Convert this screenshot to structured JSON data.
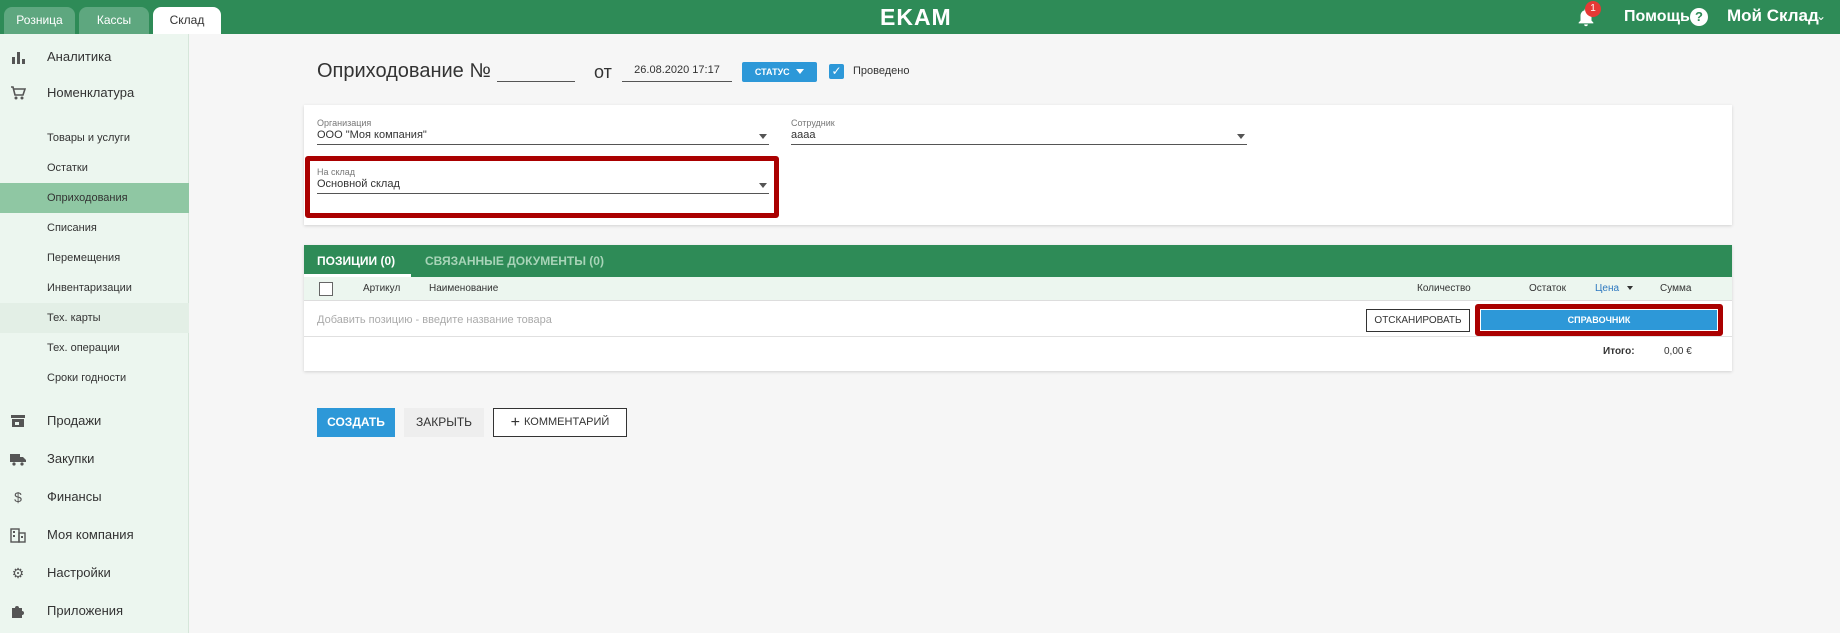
{
  "topbar": {
    "tabs": [
      {
        "label": "Розница"
      },
      {
        "label": "Кассы"
      },
      {
        "label": "Склад"
      }
    ],
    "logo": "EKAM",
    "notifications_count": "1",
    "help_label": "Помощь",
    "help_icon": "?",
    "account_label": "Мой Склад",
    "account_chevron": "⌄"
  },
  "sidebar": {
    "items": [
      {
        "label": "Аналитика",
        "icon": "bar-chart-icon",
        "glyph": "▮"
      },
      {
        "label": "Номенклатура",
        "icon": "cart-icon",
        "glyph": "🛒"
      },
      {
        "label": "Продажи",
        "icon": "store-icon",
        "glyph": "▬"
      },
      {
        "label": "Закупки",
        "icon": "truck-icon",
        "glyph": "▰"
      },
      {
        "label": "Финансы",
        "icon": "dollar-icon",
        "glyph": "$"
      },
      {
        "label": "Моя компания",
        "icon": "building-icon",
        "glyph": "▦"
      },
      {
        "label": "Настройки",
        "icon": "gear-icon",
        "glyph": "⚙"
      },
      {
        "label": "Приложения",
        "icon": "puzzle-icon",
        "glyph": "✚"
      }
    ],
    "subitems": [
      {
        "label": "Товары и услуги"
      },
      {
        "label": "Остатки"
      },
      {
        "label": "Оприходования"
      },
      {
        "label": "Списания"
      },
      {
        "label": "Перемещения"
      },
      {
        "label": "Инвентаризации"
      },
      {
        "label": "Тех. карты"
      },
      {
        "label": "Тех. операции"
      },
      {
        "label": "Сроки годности"
      }
    ]
  },
  "header": {
    "title": "Оприходование  №",
    "number": "",
    "from_label": "от",
    "date": "26.08.2020 17:17",
    "status_label": "СТАТУС",
    "conducted_label": "Проведено",
    "check_mark": "✓"
  },
  "form": {
    "organization_label": "Организация",
    "organization_value": "ООО \"Моя компания\"",
    "employee_label": "Сотрудник",
    "employee_value": "аааа",
    "warehouse_label": "На склад",
    "warehouse_value": "Основной склад"
  },
  "positions": {
    "tab_positions": "ПОЗИЦИИ (0)",
    "tab_related": "СВЯЗАННЫЕ ДОКУМЕНТЫ (0)",
    "columns": {
      "article": "Артикул",
      "name": "Наименование",
      "quantity": "Количество",
      "stock": "Остаток",
      "price": "Цена",
      "sum": "Сумма"
    },
    "add_placeholder": "Добавить позицию - введите название товара",
    "scan_label": "ОТСКАНИРОВАТЬ",
    "reference_label": "СПРАВОЧНИК",
    "total_label": "Итого:",
    "total_value": "0,00 €"
  },
  "actions": {
    "create": "СОЗДАТЬ",
    "close": "ЗАКРЫТЬ",
    "comment": "КОММЕНТАРИЙ",
    "comment_plus": "+"
  },
  "colors": {
    "brand_green": "#2e8b57",
    "accent_blue": "#2d98d8",
    "highlight_red": "#a00000",
    "active_sidebar": "#8fc7a3"
  }
}
